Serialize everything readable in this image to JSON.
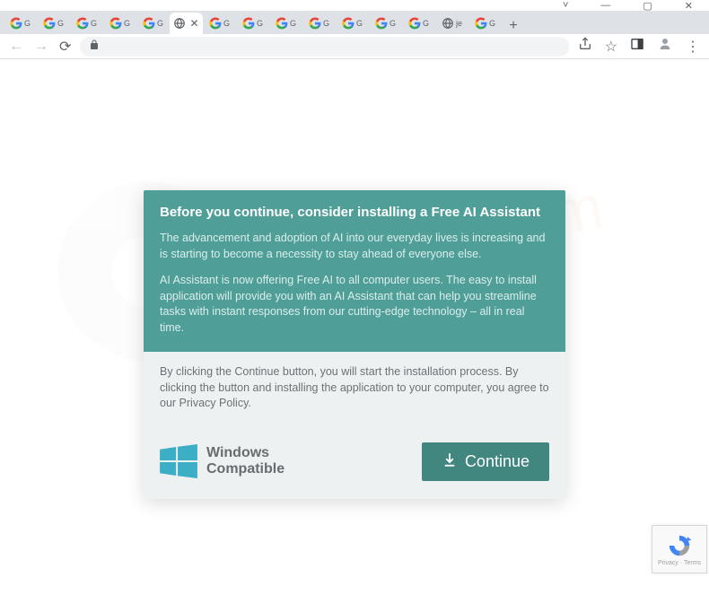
{
  "window_controls": {
    "min": "—",
    "max": "▢",
    "close": "✕",
    "down": "˅"
  },
  "tabs": [
    {
      "label": "G",
      "fav": "google"
    },
    {
      "label": "G",
      "fav": "google"
    },
    {
      "label": "G",
      "fav": "google"
    },
    {
      "label": "G",
      "fav": "google"
    },
    {
      "label": "G",
      "fav": "google"
    },
    {
      "label": "",
      "fav": "globe",
      "active": true
    },
    {
      "label": "G",
      "fav": "google"
    },
    {
      "label": "G",
      "fav": "google"
    },
    {
      "label": "G",
      "fav": "google"
    },
    {
      "label": "G",
      "fav": "google"
    },
    {
      "label": "G",
      "fav": "google"
    },
    {
      "label": "G",
      "fav": "google"
    },
    {
      "label": "G",
      "fav": "google"
    },
    {
      "label": "je",
      "fav": "globe"
    },
    {
      "label": "G",
      "fav": "google"
    }
  ],
  "new_tab": "+",
  "nav": {
    "back": "←",
    "forward": "→",
    "reload": "⟳"
  },
  "toolbar_icons": {
    "share": "share",
    "star": "☆",
    "panel": "❐",
    "profile": "profile",
    "menu": "⋮"
  },
  "card": {
    "heading": "Before you continue, consider installing a Free AI Assistant",
    "p1": "The advancement and adoption of AI into our everyday lives is increasing and is starting to become a necessity to stay ahead of everyone else.",
    "p2": "AI Assistant is now offering Free AI to all computer users. The easy to install application will provide you with an AI Assistant that can help you streamline tasks with instant responses from our cutting-edge technology – all in real time.",
    "terms": "By clicking the Continue button, you will start the installation process. By clicking the button and installing the application to your computer, you agree to our Privacy Policy.",
    "compat_line1": "Windows",
    "compat_line2": "Compatible",
    "continue_label": "Continue"
  },
  "recaptcha": {
    "line1": "reCAPTCHA",
    "line2": "Privacy · Terms"
  }
}
